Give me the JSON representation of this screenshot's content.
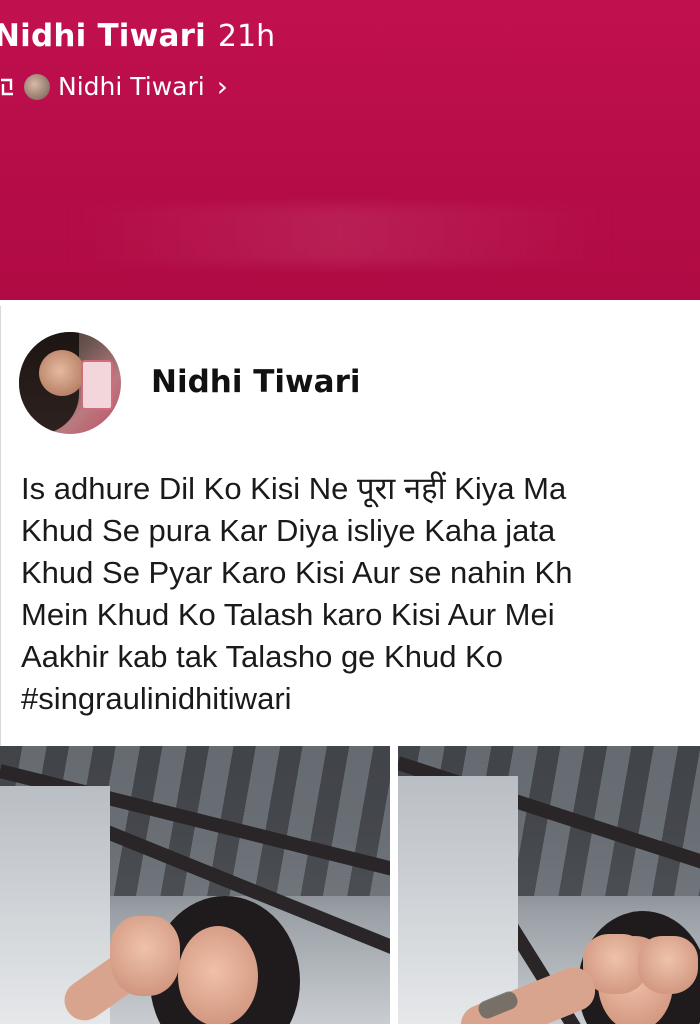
{
  "header": {
    "author": "Nidhi Tiwari",
    "time": "21h",
    "shared_from": "Nidhi Tiwari",
    "chevron": "›",
    "background_color": "#b50c47",
    "repost_icon": "repost-icon"
  },
  "post": {
    "author": "Nidhi Tiwari",
    "lines": [
      "Is adhure Dil Ko Kisi Ne पूरा नहीं Kiya Ma",
      "Khud Se pura Kar Diya isliye Kaha jata",
      "Khud Se Pyar Karo Kisi Aur se nahin Kh",
      "Mein Khud Ko Talash karo Kisi Aur Mei",
      "Aakhir kab tak Talasho ge Khud Ko",
      "#singraulinidhitiwari"
    ]
  }
}
